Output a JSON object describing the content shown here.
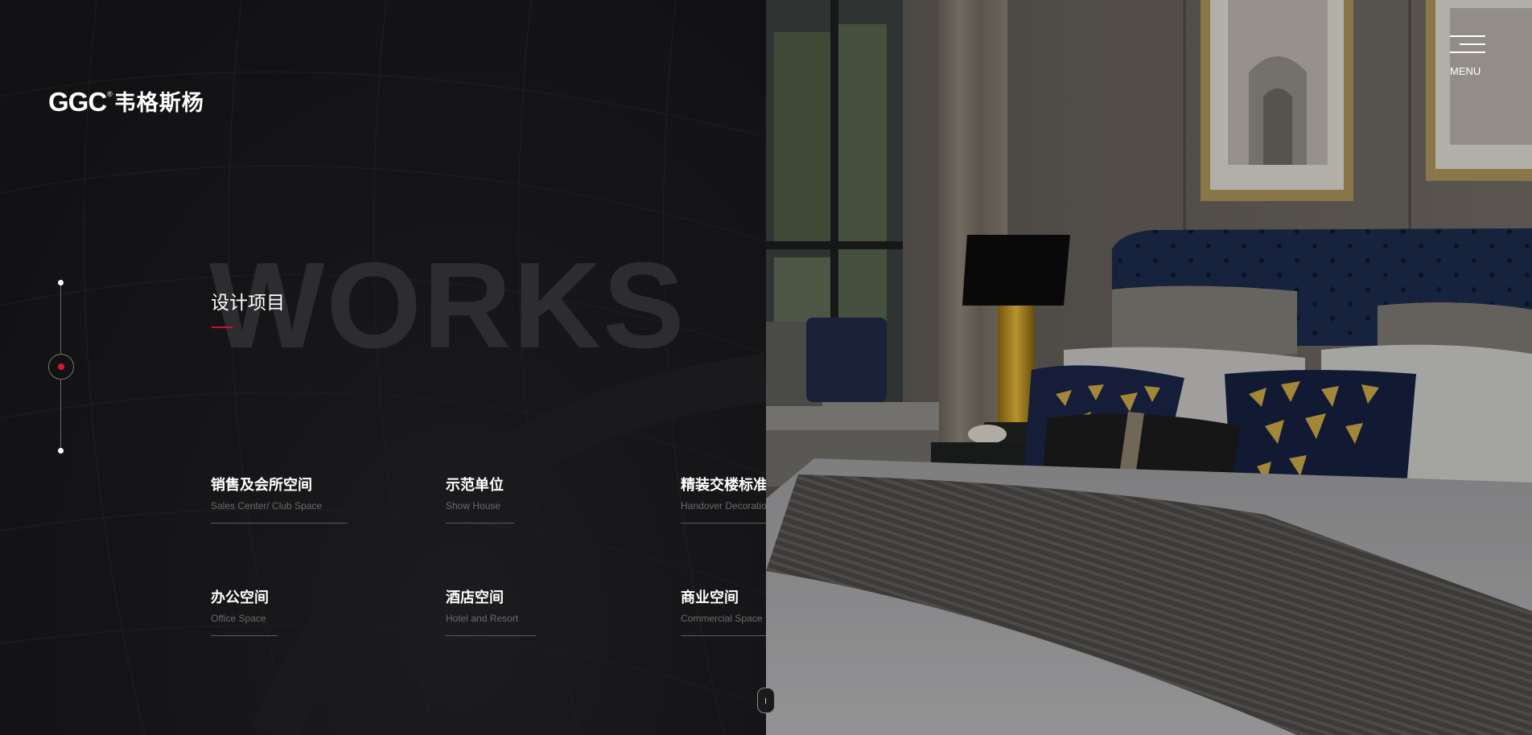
{
  "brand": {
    "logo_mark": "GGC",
    "logo_reg": "®",
    "logo_cn": "韦格斯杨"
  },
  "hero": {
    "background_word": "WORKS",
    "section_title": "设计项目"
  },
  "categories": [
    {
      "zh": "销售及会所空间",
      "en": "Sales Center/ Club Space"
    },
    {
      "zh": "示范单位",
      "en": "Show House"
    },
    {
      "zh": "精装交楼标准",
      "en": "Handover Decoration Standard"
    },
    {
      "zh": "办公空间",
      "en": "Office Space"
    },
    {
      "zh": "酒店空间",
      "en": "Hotel and Resort"
    },
    {
      "zh": "商业空间",
      "en": "Commercial Space"
    }
  ],
  "menu": {
    "label": "MENU"
  },
  "colors": {
    "accent": "#c8102e",
    "background": "#121214"
  },
  "icons": {
    "menu": "hamburger-icon",
    "scroll": "mouse-scroll-icon"
  }
}
